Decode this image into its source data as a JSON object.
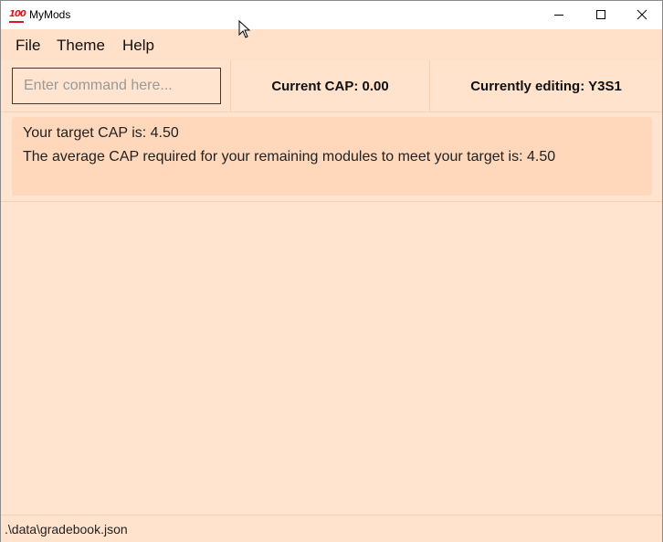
{
  "window": {
    "title": "MyMods",
    "icon": "hundred-points-emoji"
  },
  "menu": {
    "items": [
      {
        "label": "File"
      },
      {
        "label": "Theme"
      },
      {
        "label": "Help"
      }
    ]
  },
  "command": {
    "placeholder": "Enter command here...",
    "value": ""
  },
  "status": {
    "current_cap": "Current CAP: 0.00",
    "currently_editing": "Currently editing: Y3S1"
  },
  "result": {
    "line1": "Your target CAP is: 4.50",
    "line2": "The average CAP required for your remaining modules to meet your target is: 4.50"
  },
  "statusbar": {
    "path": ".\\data\\gradebook.json"
  },
  "colors": {
    "background": "#ffe5cf",
    "panel": "#ffd7bb",
    "icon_red": "#e0141e"
  }
}
